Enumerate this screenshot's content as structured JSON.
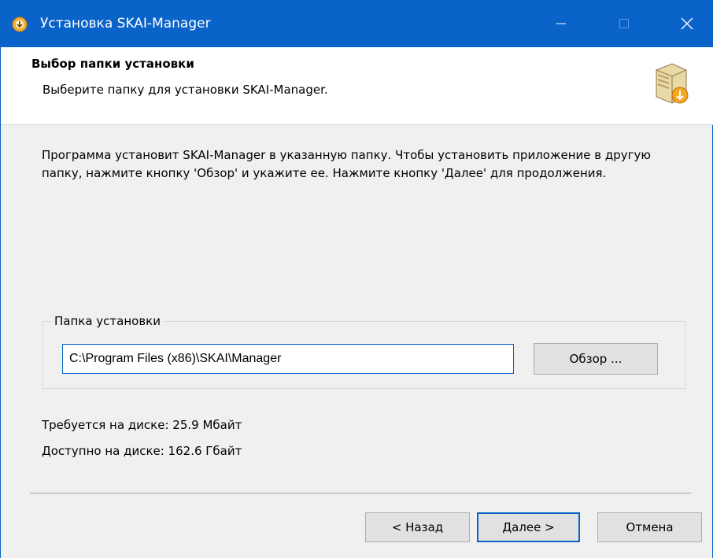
{
  "window": {
    "title": "Установка SKAI-Manager",
    "accent_color": "#0a63c9",
    "controls": {
      "minimize_icon": "minimize-icon",
      "maximize_icon": "maximize-icon",
      "close_icon": "close-icon"
    }
  },
  "header": {
    "title": "Выбор папки установки",
    "subtitle": "Выберите папку для установки SKAI-Manager.",
    "icon": "installer-box-icon"
  },
  "body": {
    "description": "Программа установит SKAI-Manager в указанную папку. Чтобы установить приложение в другую папку, нажмите кнопку 'Обзор' и укажите ее. Нажмите кнопку 'Далее' для продолжения.",
    "group_label": "Папка установки",
    "install_path": "C:\\Program Files (x86)\\SKAI\\Manager",
    "browse_label": "Обзор ...",
    "space_required": "Требуется на диске: 25.9 Мбайт",
    "space_available": "Доступно на диске: 162.6 Гбайт"
  },
  "footer": {
    "back_label": "< Назад",
    "next_label": "Далее >",
    "cancel_label": "Отмена"
  }
}
